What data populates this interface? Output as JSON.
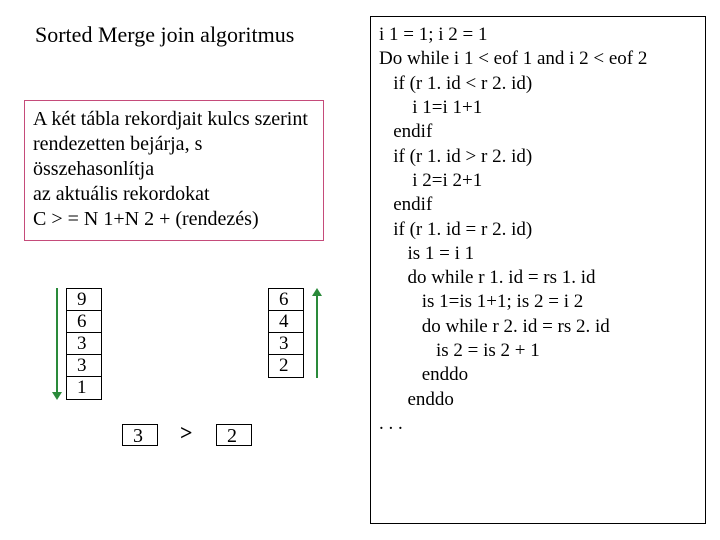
{
  "title": "Sorted Merge join algoritmus",
  "description": "A két tábla rekordjait kulcs szerint rendezetten bejárja, s összehasonlítja\naz aktuális rekordokat\nC > = N 1+N 2 + (rendezés)",
  "stackA": [
    "9",
    "6",
    "3",
    "3",
    "1"
  ],
  "stackB": [
    "6",
    "4",
    "3",
    "2"
  ],
  "compare": {
    "left": "3",
    "op": ">",
    "right": "2"
  },
  "code": "i 1 = 1; i 2 = 1\nDo while i 1 < eof 1 and i 2 < eof 2\n   if (r 1. id < r 2. id)\n       i 1=i 1+1\n   endif\n   if (r 1. id > r 2. id)\n       i 2=i 2+1\n   endif\n   if (r 1. id = r 2. id)\n      is 1 = i 1\n      do while r 1. id = rs 1. id\n         is 1=is 1+1; is 2 = i 2\n         do while r 2. id = rs 2. id\n            is 2 = is 2 + 1\n         enddo\n      enddo\n. . ."
}
